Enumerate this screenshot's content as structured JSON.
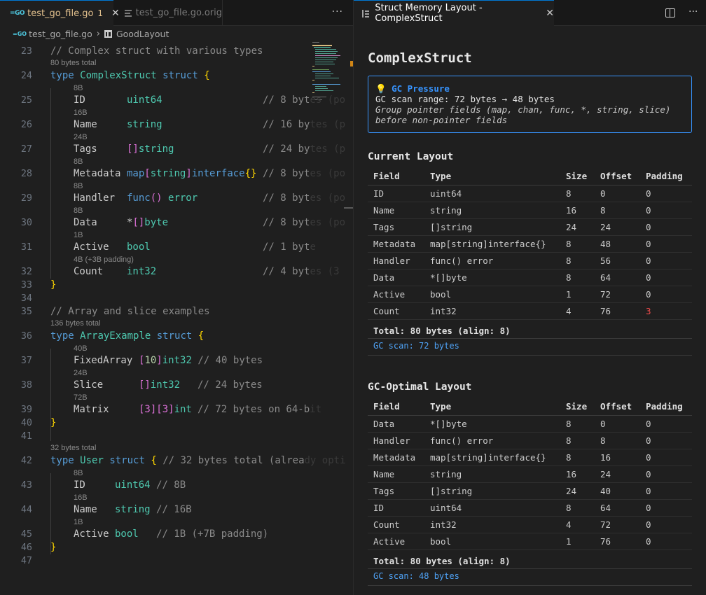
{
  "left_editor": {
    "tabs": [
      {
        "label": "test_go_file.go",
        "modified": "1",
        "close": "✕",
        "icon": "go-file-icon"
      },
      {
        "label": "test_go_file.go.orig",
        "icon": "text-file-icon"
      }
    ],
    "more": "···",
    "breadcrumb": {
      "file": "test_go_file.go",
      "symbol": "GoodLayout"
    },
    "line_numbers": [
      "23",
      "24",
      "25",
      "26",
      "27",
      "28",
      "29",
      "30",
      "31",
      "32",
      "33",
      "34",
      "35",
      "36",
      "37",
      "38",
      "39",
      "40",
      "41",
      "42",
      "43",
      "44",
      "45",
      "46",
      "47"
    ],
    "hints": {
      "complex_total": "80 bytes total",
      "id": "8B",
      "name": "16B",
      "tags": "24B",
      "metadata": "8B",
      "handler": "8B",
      "data": "8B",
      "active": "1B",
      "count": "4B (+3B padding)",
      "array_total": "136 bytes total",
      "fixed": "40B",
      "slice": "24B",
      "matrix": "72B",
      "user_total": "32 bytes total",
      "user_id": "8B",
      "user_name": "16B",
      "user_active": "1B"
    },
    "code": {
      "l23": "// Complex struct with various types",
      "l24_kw": "type",
      "l24_name": "ComplexStruct",
      "l24_kw2": "struct",
      "l24_brace": "{",
      "l25_f": "ID",
      "l25_t": "uint64",
      "l25_c": "// 8 byt",
      "l25_f2": "es (po",
      "l26_f": "Name",
      "l26_t": "string",
      "l26_c": "// 16 by",
      "l26_f2": "tes (p",
      "l27_f": "Tags",
      "l27_p": "[]",
      "l27_t": "string",
      "l27_c": "// 24 by",
      "l27_f2": "tes (p",
      "l28_f": "Metadata",
      "l28_t": "map",
      "l28_b1": "[",
      "l28_t2": "string",
      "l28_b2": "]",
      "l28_t3": "interface",
      "l28_b3": "{}",
      "l28_c": "// 8 byt",
      "l28_f2": "es (po",
      "l29_f": "Handler",
      "l29_fn": "func",
      "l29_p": "()",
      "l29_t": "error",
      "l29_c": "// 8 byt",
      "l29_f2": "es (po",
      "l30_f": "Data",
      "l30_s": "*",
      "l30_p": "[]",
      "l30_t": "byte",
      "l30_c": "// 8 byt",
      "l30_f2": "es (po",
      "l31_f": "Active",
      "l31_t": "bool",
      "l31_c": "// 1 byt",
      "l31_f2": "e",
      "l32_f": "Count",
      "l32_t": "int32",
      "l32_c": "// 4 byt",
      "l32_f2": "es (3",
      "l33": "}",
      "l35": "// Array and slice examples",
      "l36_kw": "type",
      "l36_name": "ArrayExample",
      "l36_kw2": "struct",
      "l36_brace": "{",
      "l37_f": "FixedArray",
      "l37_b": "[",
      "l37_n": "10",
      "l37_b2": "]",
      "l37_t": "int32",
      "l37_c": "// 40 bytes",
      "l38_f": "Slice",
      "l38_p": "[]",
      "l38_t": "int32",
      "l38_c": "// 24 bytes",
      "l39_f": "Matrix",
      "l39_p": "[3][3]",
      "l39_t": "int",
      "l39_c": "// 72 bytes on 64-b",
      "l39_f2": "it",
      "l40": "}",
      "l42_kw": "type",
      "l42_name": "User",
      "l42_kw2": "struct",
      "l42_brace": "{",
      "l42_c": "// 32 bytes total (alrea",
      "l42_f2": "dy opti",
      "l43_f": "ID",
      "l43_t": "uint64",
      "l43_c": "// 8B",
      "l44_f": "Name",
      "l44_t": "string",
      "l44_c": "// 16B",
      "l45_f": "Active",
      "l45_t": "bool",
      "l45_c": "// 1B (+7B padding)",
      "l46": "}"
    }
  },
  "right_panel": {
    "tab": {
      "label": "Struct Memory Layout - ComplexStruct",
      "close": "✕"
    },
    "more": "···",
    "title": "ComplexStruct",
    "gc_box": {
      "icon": "💡",
      "heading": "GC Pressure",
      "range": "GC scan range: 72 bytes → 48 bytes",
      "hint1": "Group pointer fields (map, chan, func, *, string, slice)",
      "hint2": "before non-pointer fields"
    },
    "headers": {
      "field": "Field",
      "type": "Type",
      "size": "Size",
      "offset": "Offset",
      "padding": "Padding"
    },
    "current": {
      "title": "Current Layout",
      "rows": [
        [
          "ID",
          "uint64",
          "8",
          "0",
          "0"
        ],
        [
          "Name",
          "string",
          "16",
          "8",
          "0"
        ],
        [
          "Tags",
          "[]string",
          "24",
          "24",
          "0"
        ],
        [
          "Metadata",
          "map[string]interface{}",
          "8",
          "48",
          "0"
        ],
        [
          "Handler",
          "func() error",
          "8",
          "56",
          "0"
        ],
        [
          "Data",
          "*[]byte",
          "8",
          "64",
          "0"
        ],
        [
          "Active",
          "bool",
          "1",
          "72",
          "0"
        ],
        [
          "Count",
          "int32",
          "4",
          "76",
          "3"
        ]
      ],
      "total": "Total: 80 bytes (align: 8)",
      "gc_scan": "GC scan: 72 bytes"
    },
    "optimal": {
      "title": "GC-Optimal Layout",
      "rows": [
        [
          "Data",
          "*[]byte",
          "8",
          "0",
          "0"
        ],
        [
          "Handler",
          "func() error",
          "8",
          "8",
          "0"
        ],
        [
          "Metadata",
          "map[string]interface{}",
          "8",
          "16",
          "0"
        ],
        [
          "Name",
          "string",
          "16",
          "24",
          "0"
        ],
        [
          "Tags",
          "[]string",
          "24",
          "40",
          "0"
        ],
        [
          "ID",
          "uint64",
          "8",
          "64",
          "0"
        ],
        [
          "Count",
          "int32",
          "4",
          "72",
          "0"
        ],
        [
          "Active",
          "bool",
          "1",
          "76",
          "0"
        ]
      ],
      "total": "Total: 80 bytes (align: 8)",
      "gc_scan": "GC scan: 48 bytes"
    },
    "colors": {
      "accent": "#3794ff",
      "padding_warn": "#f14c4c"
    }
  }
}
